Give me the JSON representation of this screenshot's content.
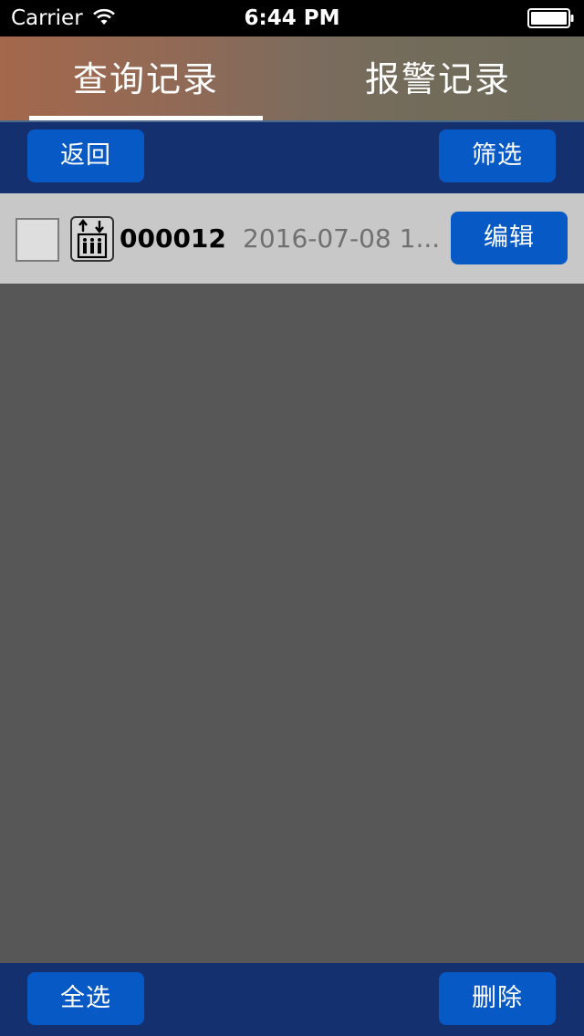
{
  "status_bar": {
    "carrier": "Carrier",
    "time": "6:44 PM"
  },
  "tabs": [
    {
      "label": "查询记录",
      "active": true
    },
    {
      "label": "报警记录",
      "active": false
    }
  ],
  "toolbar": {
    "back_label": "返回",
    "filter_label": "筛选"
  },
  "records": [
    {
      "id": "000012",
      "time": "2016-07-08 1...",
      "edit_label": "编辑",
      "icon": "elevator-icon",
      "checked": false
    }
  ],
  "bottom_bar": {
    "select_all_label": "全选",
    "delete_label": "删除"
  },
  "colors": {
    "nav_blue": "#15306e",
    "button_blue": "#0759c6",
    "row_bg": "#c8c8c8",
    "content_bg": "#575757"
  }
}
